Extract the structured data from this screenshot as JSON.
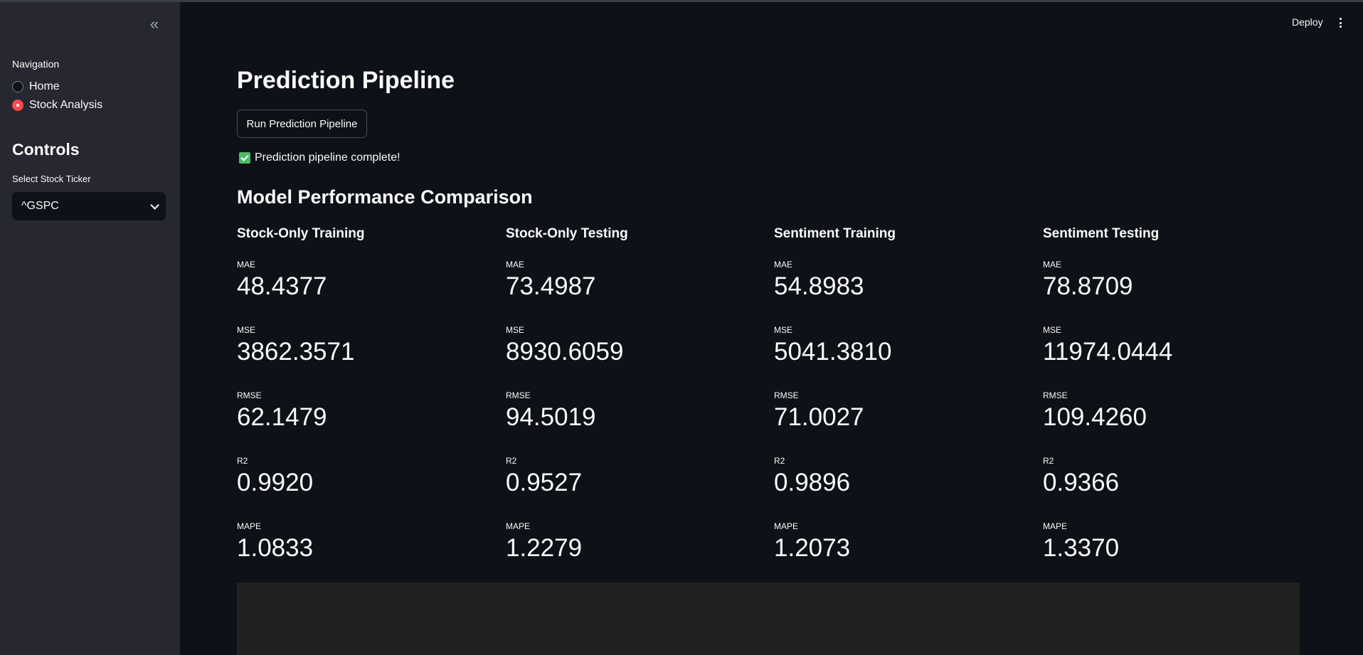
{
  "sidebar": {
    "collapse_icon": "double-chevron-left-icon",
    "navigation_label": "Navigation",
    "nav_options": [
      {
        "label": "Home",
        "selected": false
      },
      {
        "label": "Stock Analysis",
        "selected": true
      }
    ],
    "controls_title": "Controls",
    "select_label": "Select Stock Ticker",
    "select_value": "^GSPC"
  },
  "header": {
    "deploy_label": "Deploy",
    "menu_icon": "kebab-menu-icon"
  },
  "main": {
    "title": "Prediction Pipeline",
    "run_button_label": "Run Prediction Pipeline",
    "status_text": "Prediction pipeline complete!",
    "section_title": "Model Performance Comparison",
    "columns": [
      {
        "title": "Stock-Only Training",
        "metrics": [
          {
            "label": "MAE",
            "value": "48.4377"
          },
          {
            "label": "MSE",
            "value": "3862.3571"
          },
          {
            "label": "RMSE",
            "value": "62.1479"
          },
          {
            "label": "R2",
            "value": "0.9920"
          },
          {
            "label": "MAPE",
            "value": "1.0833"
          }
        ]
      },
      {
        "title": "Stock-Only Testing",
        "metrics": [
          {
            "label": "MAE",
            "value": "73.4987"
          },
          {
            "label": "MSE",
            "value": "8930.6059"
          },
          {
            "label": "RMSE",
            "value": "94.5019"
          },
          {
            "label": "R2",
            "value": "0.9527"
          },
          {
            "label": "MAPE",
            "value": "1.2279"
          }
        ]
      },
      {
        "title": "Sentiment Training",
        "metrics": [
          {
            "label": "MAE",
            "value": "54.8983"
          },
          {
            "label": "MSE",
            "value": "5041.3810"
          },
          {
            "label": "RMSE",
            "value": "71.0027"
          },
          {
            "label": "R2",
            "value": "0.9896"
          },
          {
            "label": "MAPE",
            "value": "1.2073"
          }
        ]
      },
      {
        "title": "Sentiment Testing",
        "metrics": [
          {
            "label": "MAE",
            "value": "78.8709"
          },
          {
            "label": "MSE",
            "value": "11974.0444"
          },
          {
            "label": "RMSE",
            "value": "109.4260"
          },
          {
            "label": "R2",
            "value": "0.9366"
          },
          {
            "label": "MAPE",
            "value": "1.3370"
          }
        ]
      }
    ]
  },
  "colors": {
    "background": "#0e1117",
    "sidebar": "#262730",
    "accent": "#ff4b4b",
    "success": "#4cbb6b"
  }
}
